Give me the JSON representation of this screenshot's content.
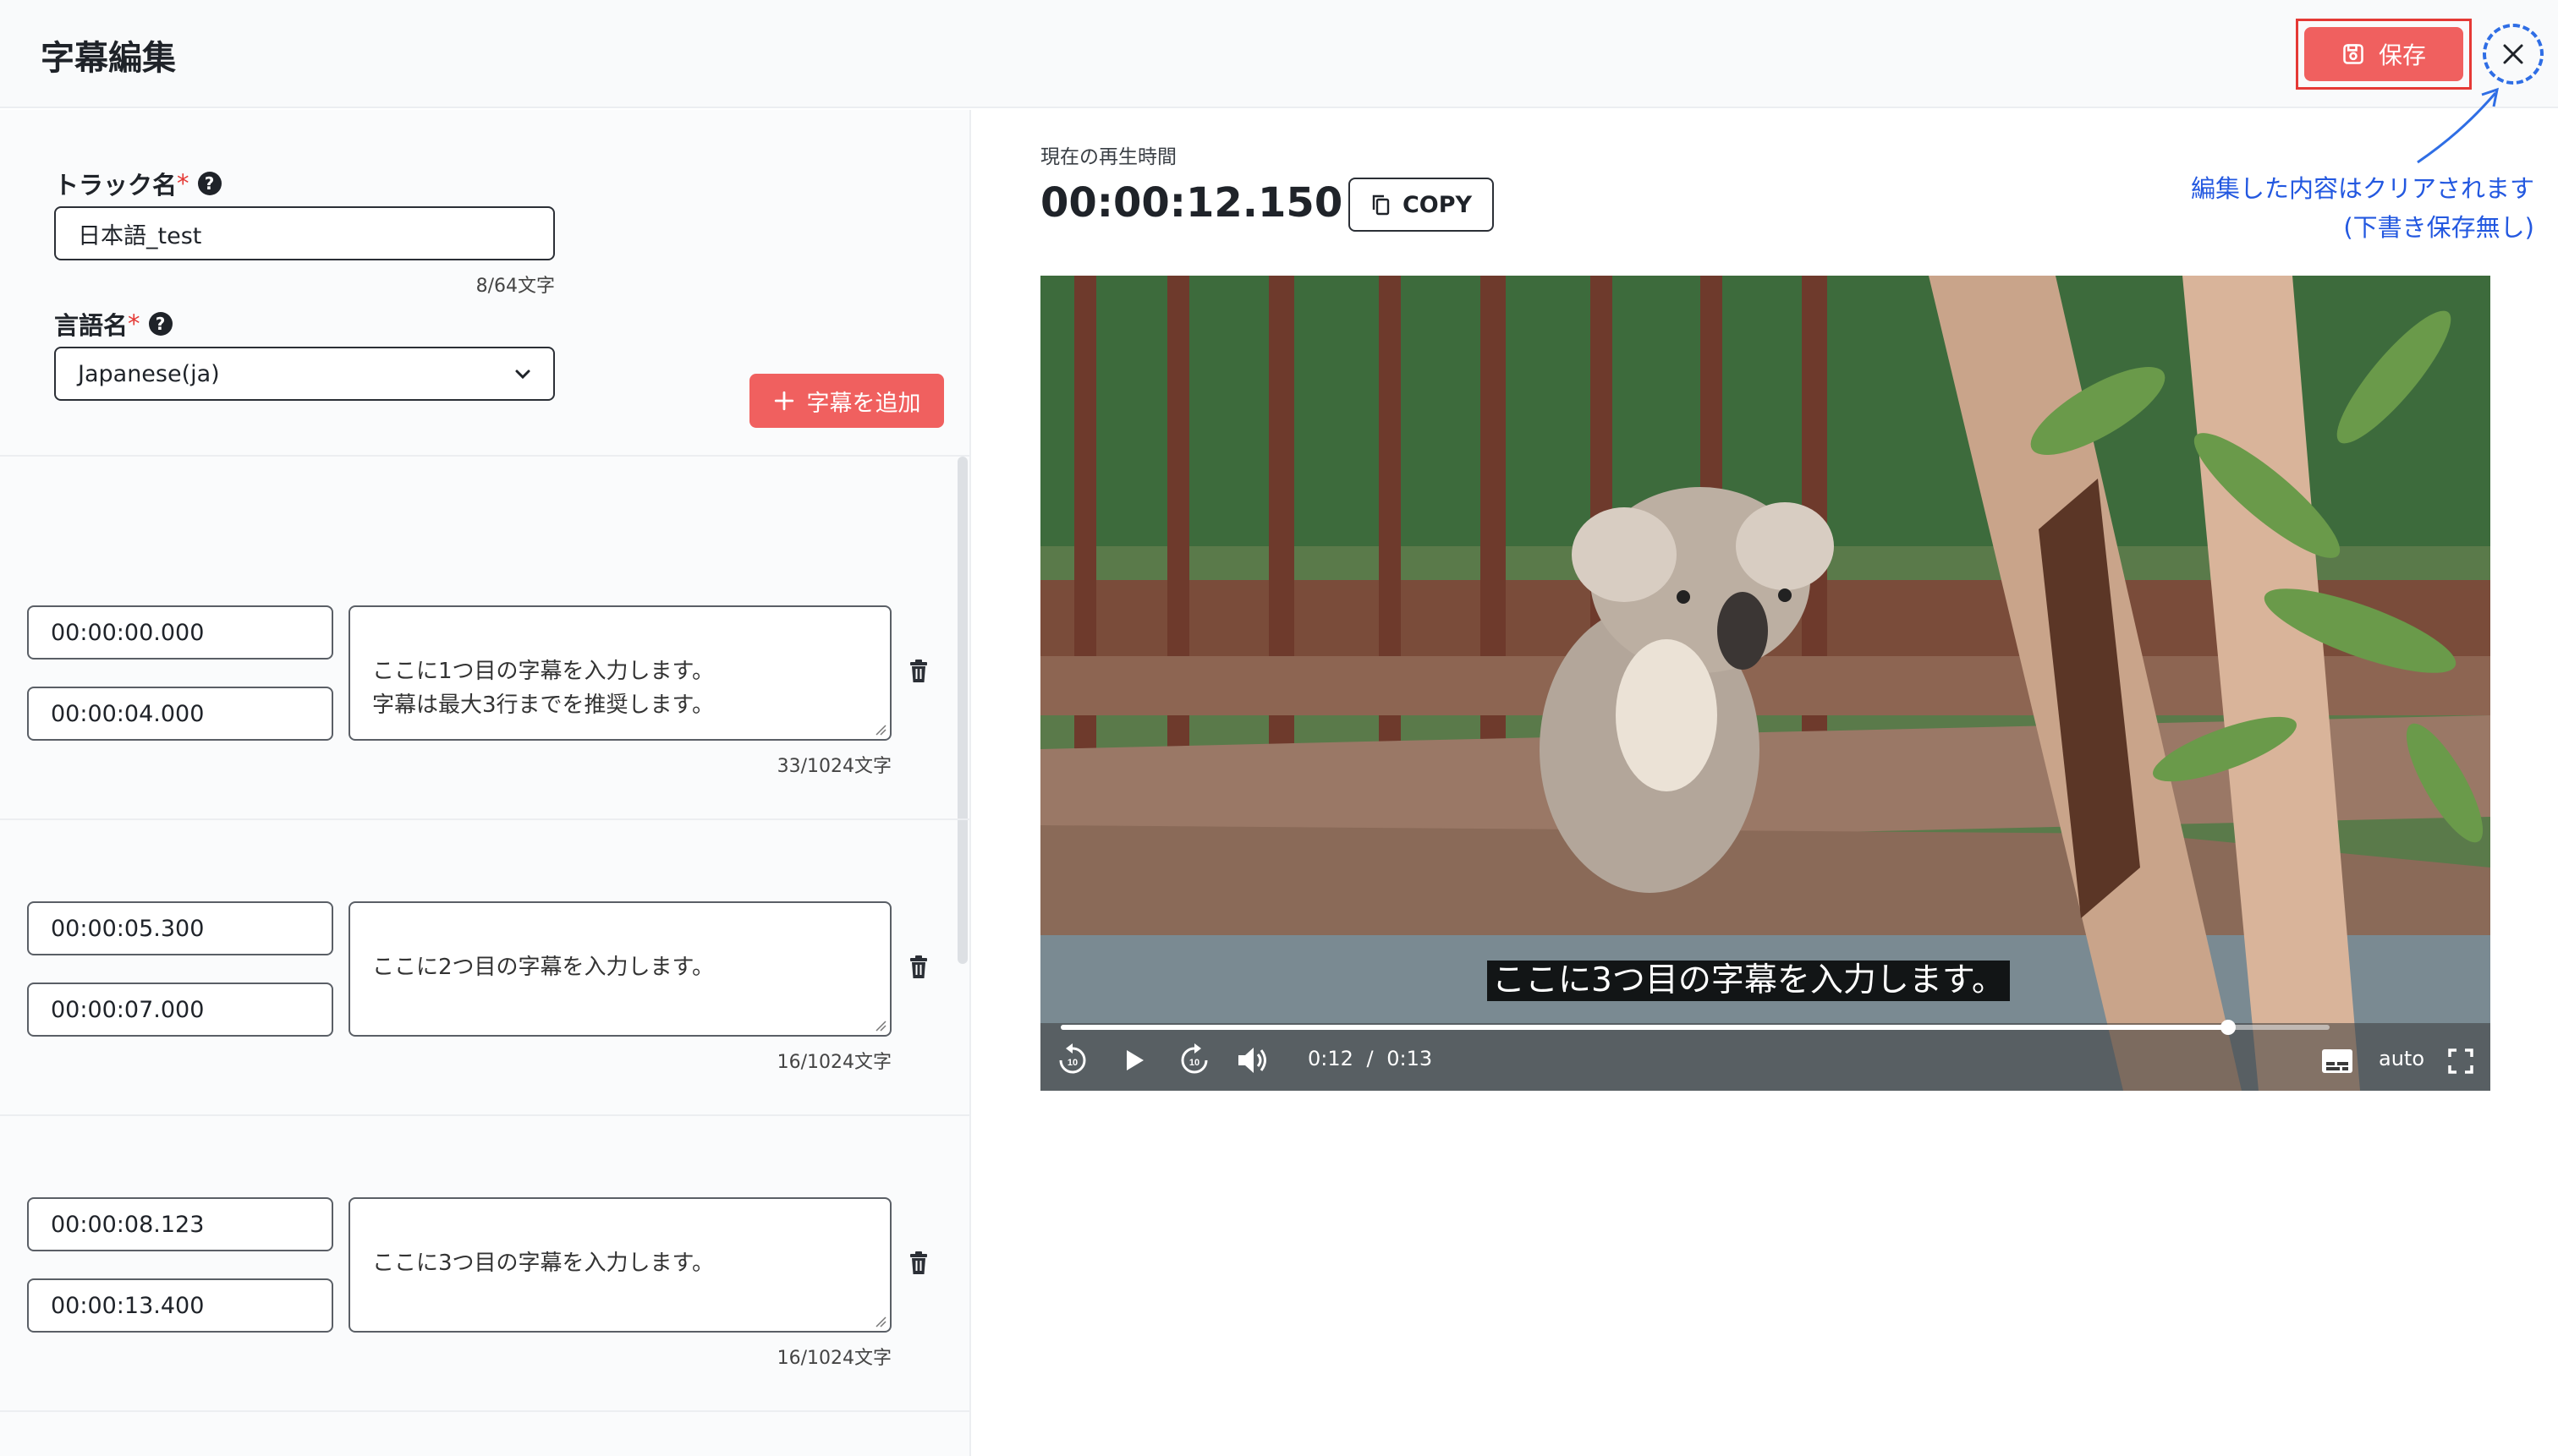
{
  "header": {
    "title": "字幕編集",
    "save_label": "保存",
    "annotation_line1": "編集した内容はクリアされます",
    "annotation_line2": "(下書き保存無し)"
  },
  "track": {
    "label": "トラック名",
    "required_mark": "*",
    "value": "日本語_test",
    "counter": "8/64文字"
  },
  "language": {
    "label": "言語名",
    "required_mark": "*",
    "selected": "Japanese(ja)"
  },
  "add_button_label": "字幕を追加",
  "subtitles": [
    {
      "start": "00:00:00.000",
      "end": "00:00:04.000",
      "text": "ここに1つ目の字幕を入力します。\n字幕は最大3行までを推奨します。",
      "counter": "33/1024文字"
    },
    {
      "start": "00:00:05.300",
      "end": "00:00:07.000",
      "text": "ここに2つ目の字幕を入力します。",
      "counter": "16/1024文字"
    },
    {
      "start": "00:00:08.123",
      "end": "00:00:13.400",
      "text": "ここに3つ目の字幕を入力します。",
      "counter": "16/1024文字"
    }
  ],
  "player": {
    "current_time_label": "現在の再生時間",
    "current_time": "00:00:12.150",
    "copy_label": "COPY",
    "caption": "ここに3つ目の字幕を入力します。",
    "elapsed": "0:12",
    "separator": "/",
    "duration": "0:13",
    "progress": 0.92,
    "quality": "auto",
    "skip_seconds": "10"
  },
  "colors": {
    "accent": "#f0605f",
    "annotation": "#2358e0",
    "highlight": "#e53935"
  }
}
